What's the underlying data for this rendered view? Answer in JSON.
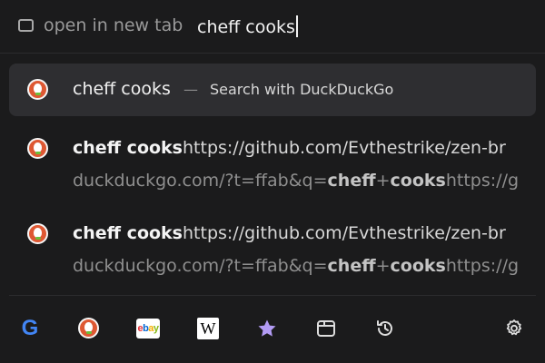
{
  "urlbar": {
    "prefix": "open in new tab",
    "value": "cheff cooks"
  },
  "suggestions": {
    "primary": {
      "title": "cheff cooks",
      "separator": "—",
      "action": "Search with DuckDuckGo",
      "icon": "duckduckgo-icon"
    },
    "results": [
      {
        "title": "cheff cooks",
        "title_url": "https://github.com/Evthestrike/zen-br",
        "url_start": "duckduckgo.com/?t=ffab&q=",
        "url_q1": "cheff",
        "url_plus": "+",
        "url_q2": "cooks",
        "url_end": "https://g",
        "icon": "duckduckgo-icon"
      },
      {
        "title": "cheff cooks",
        "title_url": "https://github.com/Evthestrike/zen-br",
        "url_start": "duckduckgo.com/?t=ffab&q=",
        "url_q1": "cheff",
        "url_plus": "+",
        "url_q2": "cooks",
        "url_end": "https://g",
        "icon": "duckduckgo-icon"
      }
    ]
  },
  "engines": {
    "google": "G",
    "ebay": [
      "e",
      "b",
      "a",
      "y"
    ],
    "wikipedia": "W",
    "items": [
      "google-icon",
      "duckduckgo-icon",
      "ebay-icon",
      "wikipedia-icon",
      "bookmarks-icon",
      "tabs-icon",
      "history-icon",
      "settings-icon"
    ]
  },
  "colors": {
    "background": "#1b1b1c",
    "selected_row": "#2e2e31",
    "bookmark_star": "#b39cf5",
    "duckduckgo": "#de5833"
  }
}
